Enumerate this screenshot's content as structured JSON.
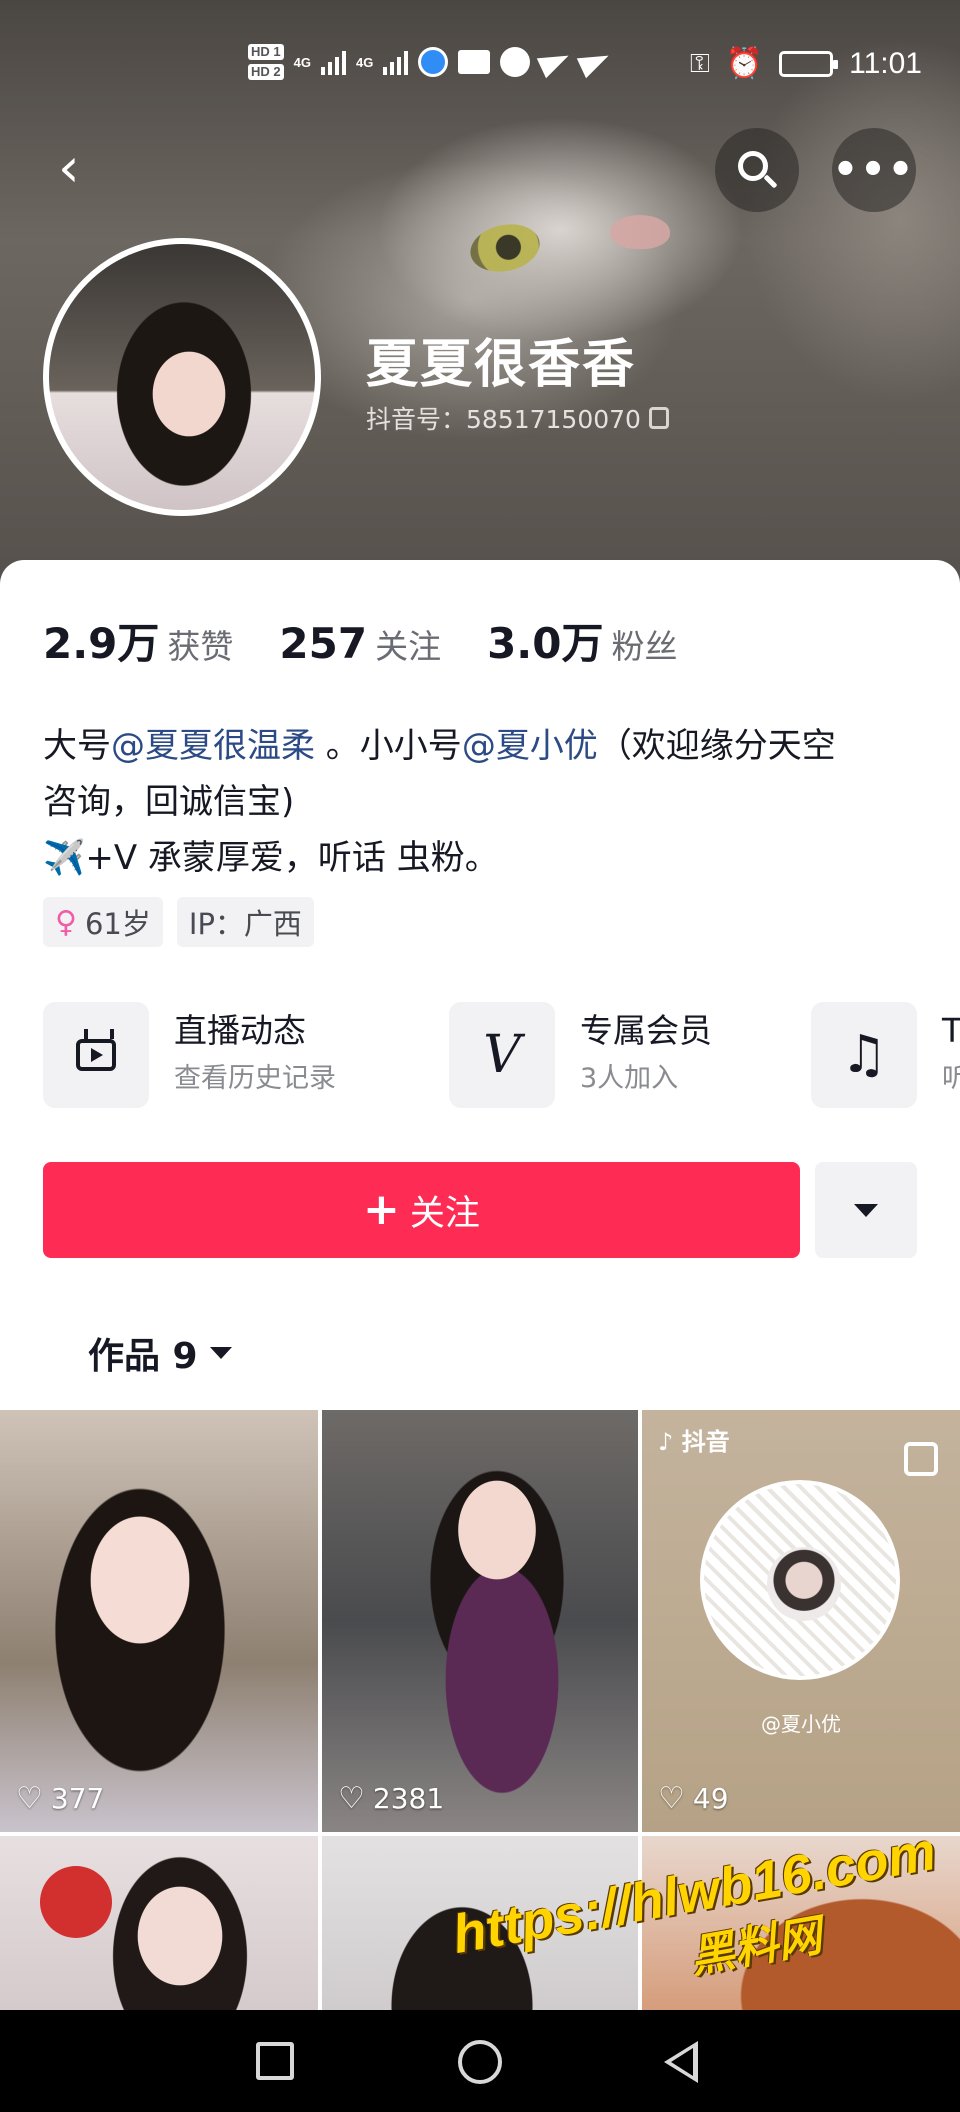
{
  "status_bar": {
    "hd1": "HD 1",
    "hd2": "HD 2",
    "net1": "4G",
    "net2": "4G",
    "time": "11:01",
    "icons": [
      "signal-icon",
      "qq-icon",
      "mail-icon",
      "telegram-icon",
      "key-icon",
      "alarm-icon",
      "battery-charging-icon"
    ]
  },
  "profile": {
    "nickname": "夏夏很香香",
    "douyin_id": "抖音号：58517150070"
  },
  "stats": {
    "likes_value": "2.9万",
    "likes_label": "获赞",
    "following_value": "257",
    "following_label": "关注",
    "followers_value": "3.0万",
    "followers_label": "粉丝"
  },
  "bio": {
    "line1_a": "大号",
    "mention1": "@夏夏很温柔",
    "line1_b": " 。小小号",
    "mention2": "@夏小优",
    "line1_c": "（欢迎缘分天空",
    "line2": "咨询，回诚信宝)",
    "line3": "✈️+V 承蒙厚爱，听话 虫粉。"
  },
  "tags": {
    "age": "61岁",
    "ip": "IP：广西"
  },
  "entries": [
    {
      "title": "直播动态",
      "subtitle": "查看历史记录",
      "icon": "tv-icon"
    },
    {
      "title": "专属会员",
      "subtitle": "3人加入",
      "icon": "vip-v-icon"
    },
    {
      "title": "T",
      "subtitle": "听",
      "icon": "music-note-icon"
    }
  ],
  "actions": {
    "follow_label": "关注",
    "follow_plus": "+"
  },
  "works_tab": {
    "label": "作品 9"
  },
  "videos": [
    {
      "likes": "377"
    },
    {
      "likes": "2381"
    },
    {
      "likes": "49",
      "brand": "抖音",
      "qr_name": "@夏小优"
    },
    {
      "likes": ""
    },
    {
      "likes": ""
    },
    {
      "likes": ""
    }
  ],
  "watermark": {
    "url": "https://hlwb16.com",
    "name": "黑料网"
  },
  "colors": {
    "accent": "#fe2c55",
    "mention": "#2b4a86",
    "watermark": "#ffd400"
  }
}
